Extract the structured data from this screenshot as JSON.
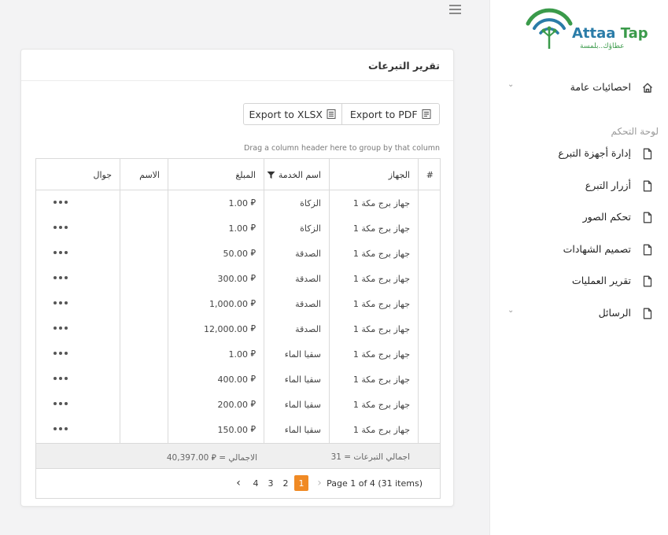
{
  "brand": {
    "name_part1": "Attaa",
    "name_part2": " Tap",
    "tagline": "عطاؤك..بلمسة"
  },
  "sidebar": {
    "items": [
      {
        "label": "احصائيات عامة",
        "icon": "home-icon",
        "chevron": "⌄"
      },
      {
        "label": "إدارة أجهزة التبرع",
        "icon": "file-icon"
      },
      {
        "label": "أزرار التبرع",
        "icon": "file-icon"
      },
      {
        "label": "تحكم الصور",
        "icon": "file-icon"
      },
      {
        "label": "تصميم الشهادات",
        "icon": "file-icon"
      },
      {
        "label": "تقرير العمليات",
        "icon": "file-icon"
      },
      {
        "label": "الرسائل",
        "icon": "file-icon",
        "chevron": "⌄"
      }
    ],
    "section_title": "لوحة التحكم"
  },
  "card": {
    "title": "تقرير التبرعات",
    "export_pdf": "Export to PDF",
    "export_xlsx": "Export to XLSX",
    "group_hint": "Drag a column header here to group by that column"
  },
  "grid": {
    "headers": {
      "num": "#",
      "device": "الجهاز",
      "service": "اسم الخدمة",
      "amount": "المبلغ",
      "name": "الاسم",
      "mobile": "جوال"
    },
    "rows": [
      {
        "device": "جهاز برج مكة 1",
        "service": "الزكاة",
        "amount": "1.00"
      },
      {
        "device": "جهاز برج مكة 1",
        "service": "الزكاة",
        "amount": "1.00"
      },
      {
        "device": "جهاز برج مكة 1",
        "service": "الصدقة",
        "amount": "50.00"
      },
      {
        "device": "جهاز برج مكة 1",
        "service": "الصدقة",
        "amount": "300.00"
      },
      {
        "device": "جهاز برج مكة 1",
        "service": "الصدقة",
        "amount": "1,000.00"
      },
      {
        "device": "جهاز برج مكة 1",
        "service": "الصدقة",
        "amount": "12,000.00"
      },
      {
        "device": "جهاز برج مكة 1",
        "service": "سقيا الماء",
        "amount": "1.00"
      },
      {
        "device": "جهاز برج مكة 1",
        "service": "سقيا الماء",
        "amount": "400.00"
      },
      {
        "device": "جهاز برج مكة 1",
        "service": "سقيا الماء",
        "amount": "200.00"
      },
      {
        "device": "جهاز برج مكة 1",
        "service": "سقيا الماء",
        "amount": "150.00"
      }
    ],
    "currency_symbol": "⃁",
    "footer_count": "اجمالي التبرعات = 31",
    "footer_total": "الاجمالي = ⃁ 40,397.00"
  },
  "pager": {
    "info": "Page 1 of 4 (31 items)",
    "pages": [
      "1",
      "2",
      "3",
      "4"
    ],
    "active": "1"
  },
  "colors": {
    "accent": "#f08a24",
    "brand_blue": "#2a7ca8",
    "brand_green": "#3a9a4a"
  }
}
